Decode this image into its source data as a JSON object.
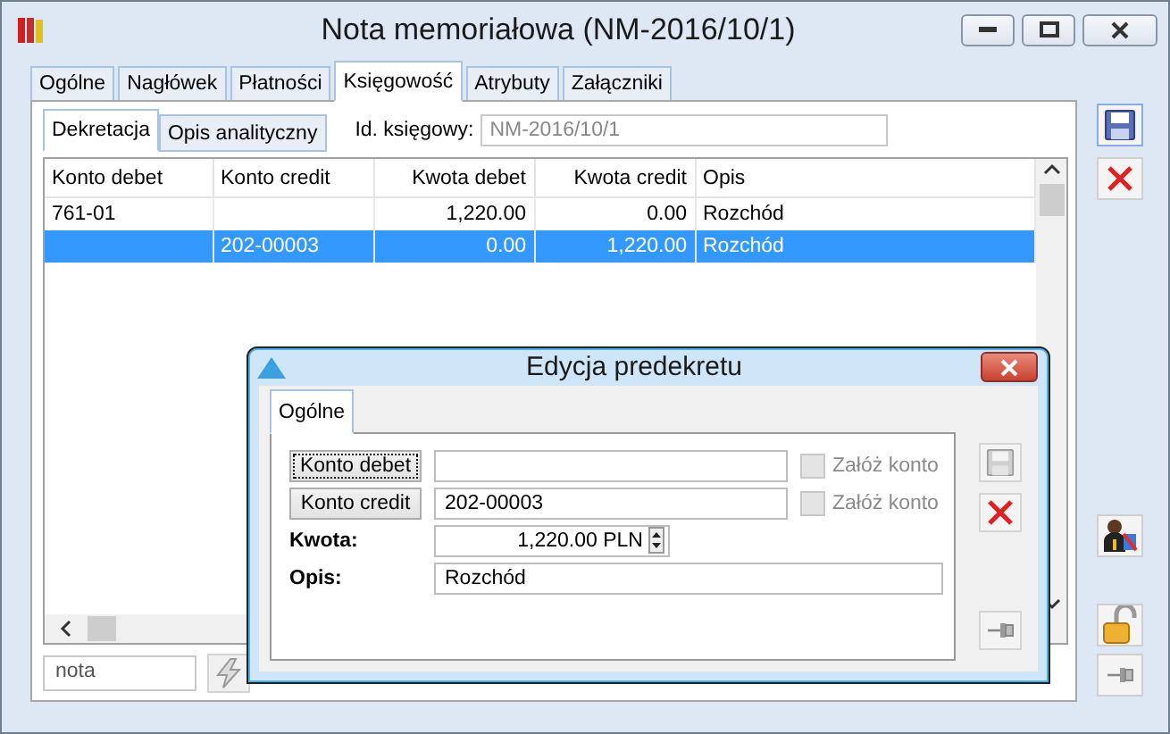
{
  "window": {
    "title": "Nota memoriałowa (NM-2016/10/1)"
  },
  "tabs": [
    {
      "label": "Ogólne",
      "selected": false
    },
    {
      "label": "Nagłówek",
      "selected": false
    },
    {
      "label": "Płatności",
      "selected": false
    },
    {
      "label": "Księgowość",
      "selected": true
    },
    {
      "label": "Atrybuty",
      "selected": false
    },
    {
      "label": "Załączniki",
      "selected": false
    }
  ],
  "subtabs": [
    {
      "label": "Dekretacja",
      "selected": true
    },
    {
      "label": "Opis analityczny",
      "selected": false
    }
  ],
  "id_field": {
    "label": "Id. księgowy:",
    "value": "NM-2016/10/1",
    "disabled": true
  },
  "table": {
    "columns": [
      "Konto debet",
      "Konto credit",
      "Kwota debet",
      "Kwota credit",
      "Opis"
    ],
    "rows": [
      {
        "cells": [
          "761-01",
          "",
          "1,220.00",
          "0.00",
          "Rozchód"
        ],
        "selected": false
      },
      {
        "cells": [
          "",
          "202-00003",
          "0.00",
          "1,220.00",
          "Rozchód"
        ],
        "selected": true
      }
    ]
  },
  "filter": {
    "value": "nota"
  },
  "dialog": {
    "title": "Edycja predekretu",
    "tabs": [
      {
        "label": "Ogólne",
        "selected": true
      }
    ],
    "fields": [
      {
        "kind": "account",
        "label": "Konto debet",
        "focused": true,
        "checkbox": {
          "label": "Załóż konto",
          "checked": false,
          "disabled": true
        }
      },
      {
        "kind": "account",
        "label": "Konto credit",
        "value": "202-00003",
        "focused": false,
        "checkbox": {
          "label": "Załóż konto",
          "checked": false,
          "disabled": true
        }
      },
      {
        "kind": "amount",
        "label": "Kwota:",
        "value": "1,220.00 PLN"
      },
      {
        "kind": "text",
        "label": "Opis:",
        "value": "Rozchód"
      }
    ]
  }
}
